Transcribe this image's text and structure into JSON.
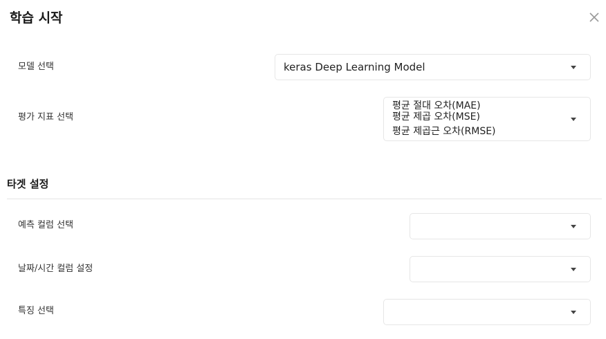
{
  "dialog": {
    "title": "학습 시작",
    "close_icon": "close-icon"
  },
  "model_select": {
    "label": "모델 선택",
    "value": "keras Deep Learning Model"
  },
  "metric_select": {
    "label": "평가 지표 선택",
    "values": [
      "평균 절대 오차(MAE)",
      "평균 제곱 오차(MSE)",
      "평균 제곱근 오차(RMSE)"
    ]
  },
  "target_section": {
    "title": "타겟 설정",
    "prediction_column": {
      "label": "예측 컬럼 선택",
      "value": ""
    },
    "datetime_column": {
      "label": "날짜/시간 컬럼 설정",
      "value": ""
    },
    "feature_select": {
      "label": "특징 선택",
      "value": ""
    }
  },
  "colors": {
    "border": "#e6e6e6",
    "divider": "#e5e5e5",
    "text": "#222222",
    "icon": "#999999"
  }
}
